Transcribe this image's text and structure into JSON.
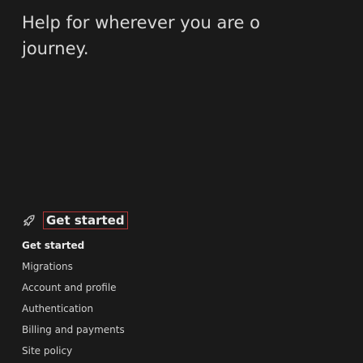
{
  "hero": {
    "line1": "Help for wherever you are o",
    "line2": "journey."
  },
  "section": {
    "icon": "rocket-icon",
    "title": "Get started"
  },
  "nav": {
    "items": [
      {
        "label": "Get started",
        "active": true
      },
      {
        "label": "Migrations"
      },
      {
        "label": "Account and profile"
      },
      {
        "label": "Authentication"
      },
      {
        "label": "Billing and payments"
      },
      {
        "label": "Site policy"
      }
    ]
  },
  "colors": {
    "background": "#1a1a1a",
    "text": "#d8d8d8",
    "focus_outline": "#b03535"
  }
}
